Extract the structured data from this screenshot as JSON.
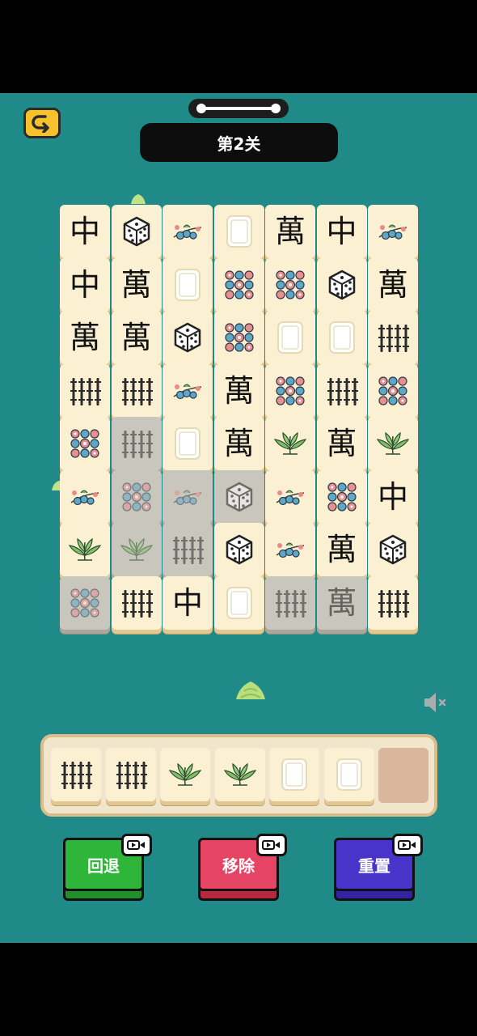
{
  "level": {
    "title": "第2关"
  },
  "board": {
    "tiles": [
      {
        "suit": "zhong",
        "dim": false
      },
      {
        "suit": "dice",
        "dim": false
      },
      {
        "suit": "flower",
        "dim": false
      },
      {
        "suit": "white",
        "dim": false
      },
      {
        "suit": "wan",
        "dim": false
      },
      {
        "suit": "zhong",
        "dim": false
      },
      {
        "suit": "flower",
        "dim": false
      },
      {
        "suit": "zhong",
        "dim": false
      },
      {
        "suit": "wan",
        "dim": false
      },
      {
        "suit": "white",
        "dim": false
      },
      {
        "suit": "circles",
        "dim": false
      },
      {
        "suit": "circles",
        "dim": false
      },
      {
        "suit": "dice",
        "dim": false
      },
      {
        "suit": "wan",
        "dim": false
      },
      {
        "suit": "wan",
        "dim": false
      },
      {
        "suit": "wan",
        "dim": false
      },
      {
        "suit": "dice",
        "dim": false
      },
      {
        "suit": "circles",
        "dim": false
      },
      {
        "suit": "white",
        "dim": false
      },
      {
        "suit": "white",
        "dim": false
      },
      {
        "suit": "bamboo",
        "dim": false
      },
      {
        "suit": "bamboo",
        "dim": false
      },
      {
        "suit": "bamboo",
        "dim": false
      },
      {
        "suit": "flower",
        "dim": false
      },
      {
        "suit": "wan",
        "dim": false
      },
      {
        "suit": "circles",
        "dim": false
      },
      {
        "suit": "bamboo",
        "dim": false
      },
      {
        "suit": "circles",
        "dim": false
      },
      {
        "suit": "circles",
        "dim": false
      },
      {
        "suit": "bamboo",
        "dim": true
      },
      {
        "suit": "white",
        "dim": false
      },
      {
        "suit": "wan",
        "dim": false
      },
      {
        "suit": "plant",
        "dim": false
      },
      {
        "suit": "wan",
        "dim": false
      },
      {
        "suit": "plant",
        "dim": false
      },
      {
        "suit": "flower",
        "dim": false
      },
      {
        "suit": "circles",
        "dim": true
      },
      {
        "suit": "flower",
        "dim": true
      },
      {
        "suit": "dice",
        "dim": true
      },
      {
        "suit": "flower",
        "dim": false
      },
      {
        "suit": "circles",
        "dim": false
      },
      {
        "suit": "zhong",
        "dim": false
      },
      {
        "suit": "plant",
        "dim": false
      },
      {
        "suit": "plant",
        "dim": true
      },
      {
        "suit": "bamboo",
        "dim": true
      },
      {
        "suit": "dice",
        "dim": false
      },
      {
        "suit": "flower",
        "dim": false
      },
      {
        "suit": "wan",
        "dim": false
      },
      {
        "suit": "dice",
        "dim": false
      },
      {
        "suit": "circles",
        "dim": true
      },
      {
        "suit": "bamboo",
        "dim": false
      },
      {
        "suit": "zhong",
        "dim": false
      },
      {
        "suit": "white",
        "dim": false
      },
      {
        "suit": "bamboo",
        "dim": true
      },
      {
        "suit": "wan",
        "dim": true
      },
      {
        "suit": "bamboo",
        "dim": false
      }
    ],
    "glyphs": {
      "zhong": "中",
      "wan": "萬"
    }
  },
  "tray": {
    "slots": [
      "bamboo",
      "bamboo",
      "plant",
      "plant",
      "white",
      "white"
    ],
    "capacity": 7
  },
  "actions": {
    "undo_label": "回退",
    "remove_label": "移除",
    "reset_label": "重置"
  },
  "colors": {
    "background": "#1f8a87",
    "undo": "#2fb53a",
    "remove": "#e64464",
    "reset": "#4a33c9"
  },
  "icons": {
    "back": "back-arrow-icon",
    "mute": "speaker-muted-icon",
    "video": "video-ad-icon"
  }
}
